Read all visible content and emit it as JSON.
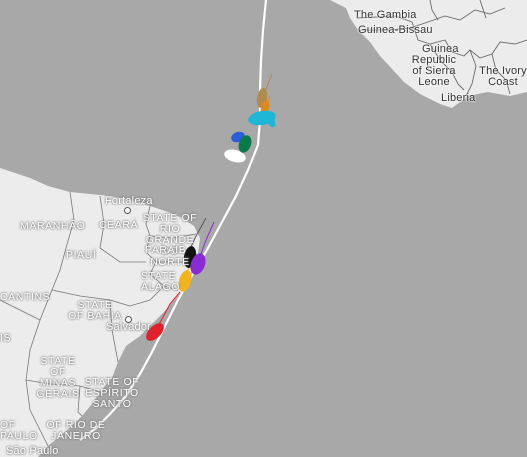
{
  "countries": {
    "gambia": "The Gambia",
    "guinea_bissau": "Guinea-Bissau",
    "guinea": "Guinea",
    "sierra_leone": "Republic of Sierra Leone",
    "liberia": "Liberia",
    "ivory_coast": "The Ivory Coast"
  },
  "states": {
    "maranhao": "MARANHÃO",
    "ceara": "CEARÁ",
    "rio_grande_do_norte": "STATE OF RIO GRANDE DO NORTE",
    "paraiba": "PARAÍB",
    "piaui": "PIAUÍ",
    "alagoas": "STATE ALAGO",
    "tocantins": "CANTINS",
    "bahia": "STATE OF BAHIA",
    "minas_gerais": "STATE OF MINAS GERAIS",
    "espirito_santo": "STATE OF ESPÍRITO SANTO",
    "sao_paulo_state": "OF PAULO",
    "rio_de_janeiro": "OF RIO DE JANEIRO",
    "left_partial": "IS"
  },
  "cities": {
    "fortaleza": "Fortaleza",
    "salvador": "Salvador",
    "sao_paulo": "São Paulo"
  },
  "colors": {
    "ocean": "#a8a8a8",
    "land": "#ececec",
    "route": "#ffffff",
    "boats": [
      "#b08a4e",
      "#e08a1e",
      "#1fb5d6",
      "#2b5fd9",
      "#0a7a4a",
      "#ffffff",
      "#111111",
      "#8a2bd4",
      "#f0b51e",
      "#e0202a"
    ]
  }
}
